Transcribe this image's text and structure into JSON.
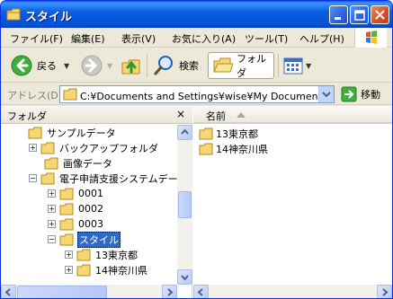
{
  "window": {
    "title": "スタイル"
  },
  "menu": [
    "ファイル(F)",
    "編集(E)",
    "表示(V)",
    "お気に入り(A)",
    "ツール(T)",
    "ヘルプ(H)"
  ],
  "toolbar": {
    "back_label": "戻る",
    "search_label": "検索",
    "folders_label": "フォルダ"
  },
  "address": {
    "label": "アドレス(D)",
    "value": "C:¥Documents and Settings¥wise¥My Documents¥電",
    "go_label": "移動"
  },
  "folder_pane": {
    "title": "フォルダ",
    "close": "×",
    "tree": [
      {
        "label": "サンプルデータ",
        "expander": ""
      },
      {
        "label": "バックアップフォルダ",
        "expander": "+"
      },
      {
        "label": "画像データ",
        "expander": ""
      },
      {
        "label": "電子申請支援システムデー",
        "expander": "−"
      },
      {
        "label": "0001",
        "expander": "+"
      },
      {
        "label": "0002",
        "expander": "+"
      },
      {
        "label": "0003",
        "expander": "+"
      },
      {
        "label": "スタイル",
        "expander": "−",
        "selected": true
      },
      {
        "label": "13東京都",
        "expander": "+"
      },
      {
        "label": "14神奈川県",
        "expander": "+"
      }
    ]
  },
  "list": {
    "column": "名前",
    "items": [
      "13東京都",
      "14神奈川県"
    ]
  },
  "colors": {
    "title_blue": "#0a5fe0",
    "selection": "#316ac5",
    "folder_yellow": "#f7d774"
  }
}
